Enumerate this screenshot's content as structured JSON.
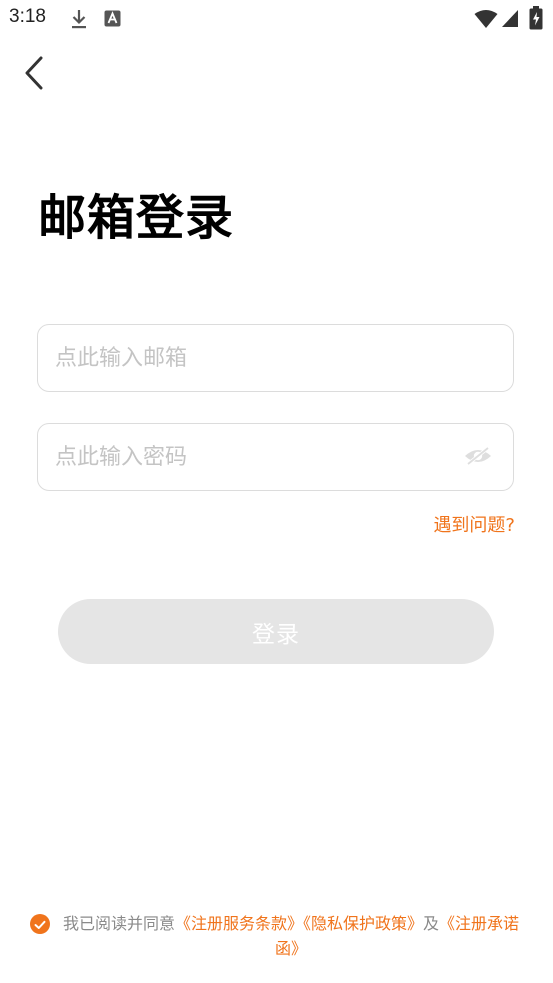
{
  "status_bar": {
    "time": "3:18",
    "left_icons": [
      "download-icon",
      "keyboard-a-icon"
    ],
    "right_icons": [
      "wifi-icon",
      "signal-icon",
      "battery-charging-icon"
    ]
  },
  "nav": {
    "back_icon": "chevron-left-icon"
  },
  "page": {
    "title": "邮箱登录"
  },
  "form": {
    "email_placeholder": "点此输入邮箱",
    "email_value": "",
    "password_placeholder": "点此输入密码",
    "password_value": "",
    "eye_icon": "eye-off-icon",
    "help_link": "遇到问题?",
    "login_label": "登录"
  },
  "agreement": {
    "checked": true,
    "prefix": "我已阅读并同意",
    "terms_link": "《注册服务条款》",
    "privacy_link": "《隐私保护政策》",
    "and_text": "及",
    "commitment_link": "《注册承诺函》"
  },
  "colors": {
    "accent": "#f0741c",
    "button_disabled": "#e5e5e5",
    "border": "#dcdcdc",
    "placeholder": "#c4c4c4"
  }
}
